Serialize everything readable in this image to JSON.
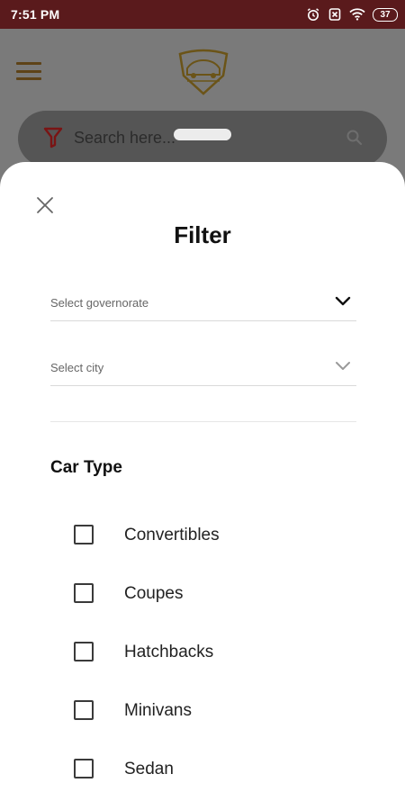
{
  "status_bar": {
    "time": "7:51 PM",
    "battery": "37",
    "icons": [
      "alarm-icon",
      "sim-off-icon",
      "wifi-icon",
      "battery-icon"
    ]
  },
  "background": {
    "search": {
      "placeholder": "Search here..."
    },
    "icons": [
      "menu-icon",
      "logo",
      "filter-icon",
      "search-icon"
    ]
  },
  "filter": {
    "title": "Filter",
    "governorate_placeholder": "Select governorate",
    "city_placeholder": "Select city",
    "car_type_title": "Car Type",
    "car_types": [
      {
        "label": "Convertibles",
        "checked": false
      },
      {
        "label": "Coupes",
        "checked": false
      },
      {
        "label": "Hatchbacks",
        "checked": false
      },
      {
        "label": "Minivans",
        "checked": false
      },
      {
        "label": "Sedan",
        "checked": false
      }
    ]
  },
  "colors": {
    "status_bar": "#5a1a1c",
    "accent": "#8b1a1a",
    "overlay": "#7a7a7a"
  }
}
